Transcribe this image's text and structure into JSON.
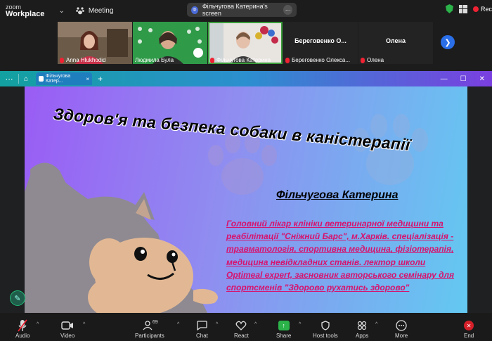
{
  "topbar": {
    "brand_small": "zoom",
    "brand_large": "Workplace",
    "meeting_label": "Meeting",
    "share_pill": "Фільчугова Катерина's screen",
    "share_initial": "Ф",
    "rec_label": "Rec"
  },
  "participants": [
    {
      "name": "Anna Hlukhodid"
    },
    {
      "name": "Людмила Була"
    },
    {
      "name": "Фільчугова Катерина"
    },
    {
      "big": "Береговенко  О...",
      "name": "Береговенко Олекса..."
    },
    {
      "big": "Олена",
      "name": "Олена"
    }
  ],
  "browser": {
    "tab_label": "Фільчугова Катер..."
  },
  "slide": {
    "title": "Здоров'я та безпека собаки  в каністерапії",
    "author": "Фільчугова Катерина",
    "bio": "Головний лікар клініки ветеринарної медицини та реабілітації \"Сніжний Барс\", м.Харків. спеціалізація - травматологія, спортивна медицина, фізіотерапія, медицина невідкладних станів. лектор школи Optimeal expert, засновник авторського семінару для спортсменів \"Здорово рухатись здорово\""
  },
  "toolbar": {
    "audio": "Audio",
    "video": "Video",
    "participants": "Participants",
    "participants_count": "69",
    "chat": "Chat",
    "react": "React",
    "share": "Share",
    "host_tools": "Host tools",
    "apps": "Apps",
    "more": "More",
    "end": "End"
  },
  "colors": {
    "share_green": "#2bb34a",
    "end_red": "#d5202a",
    "bio_pink": "#d6146e"
  }
}
